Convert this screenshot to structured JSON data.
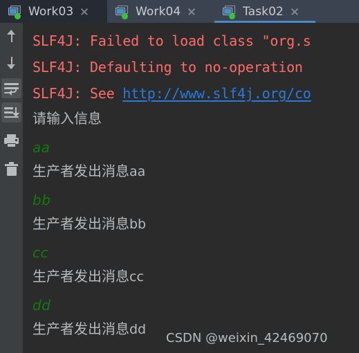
{
  "tabs": [
    {
      "label": "Work03",
      "icon": "run-config-icon",
      "close_icon": "close-icon",
      "active": false
    },
    {
      "label": "Work04",
      "icon": "run-config-icon",
      "close_icon": "close-icon",
      "active": false
    },
    {
      "label": "Task02",
      "icon": "run-config-icon",
      "close_icon": "close-icon",
      "active": true
    }
  ],
  "toolbar": {
    "items": [
      {
        "name": "up-arrow-icon",
        "tooltip": "Up the Stack Trace"
      },
      {
        "name": "down-arrow-icon",
        "tooltip": "Down the Stack Trace"
      },
      {
        "name": "soft-wrap-icon",
        "tooltip": "Soft-Wrap"
      },
      {
        "name": "scroll-to-end-icon",
        "tooltip": "Scroll to End"
      },
      {
        "name": "print-icon",
        "tooltip": "Print"
      },
      {
        "name": "trash-icon",
        "tooltip": "Clear All"
      }
    ]
  },
  "console": {
    "lines": [
      {
        "type": "error",
        "text": "SLF4J: Failed to load class \"org.s"
      },
      {
        "type": "error",
        "text": "SLF4J: Defaulting to no-operation"
      },
      {
        "type": "error_link",
        "prefix": "SLF4J: See ",
        "link": "http://www.slf4j.org/co"
      },
      {
        "type": "output",
        "text": "请输入信息"
      },
      {
        "type": "input",
        "text": "aa"
      },
      {
        "type": "output",
        "text": "生产者发出消息",
        "latin": "aa"
      },
      {
        "type": "input",
        "text": "bb"
      },
      {
        "type": "output",
        "text": "生产者发出消息",
        "latin": "bb"
      },
      {
        "type": "input",
        "text": "cc"
      },
      {
        "type": "output",
        "text": "生产者发出消息",
        "latin": "cc"
      },
      {
        "type": "input",
        "text": "dd"
      },
      {
        "type": "output",
        "text": "生产者发出消息",
        "latin": "dd"
      }
    ],
    "watermark": "CSDN @weixin_42469070"
  },
  "colors": {
    "console_bg": "#2b2b2b",
    "gutter_bg": "#3c3f41",
    "tabbar_bg": "#3c4350",
    "tab_active_underline": "#4a88c7",
    "error_text": "#ff6b68",
    "link_text": "#287bde",
    "output_text": "#b6babd",
    "input_text": "#127a12",
    "running_dot": "#3dc13d"
  }
}
